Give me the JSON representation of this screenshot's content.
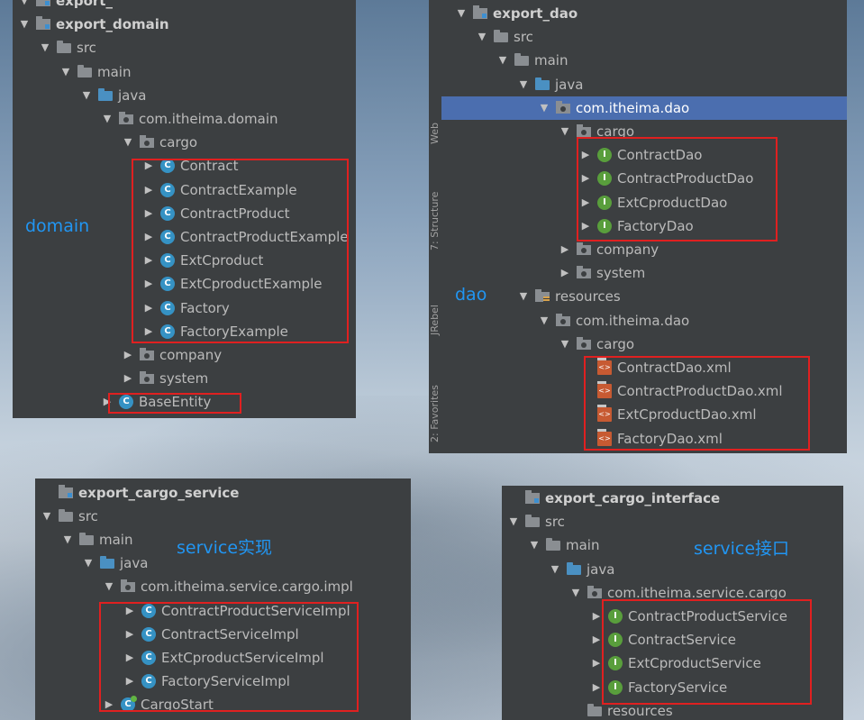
{
  "panels": {
    "domain": {
      "rows": [
        {
          "label": "export_",
          "icon": "module-icon",
          "kind": "module"
        },
        {
          "label": "export_domain",
          "icon": "module-icon",
          "kind": "module"
        },
        {
          "label": "src",
          "icon": "folder-icon",
          "kind": "folder"
        },
        {
          "label": "main",
          "icon": "folder-icon",
          "kind": "folder"
        },
        {
          "label": "java",
          "icon": "source-folder-icon",
          "kind": "source"
        },
        {
          "label": "com.itheima.domain",
          "icon": "package-icon",
          "kind": "package"
        },
        {
          "label": "cargo",
          "icon": "package-icon",
          "kind": "package"
        },
        {
          "label": "Contract",
          "icon": "class-icon",
          "kind": "class"
        },
        {
          "label": "ContractExample",
          "icon": "class-icon",
          "kind": "class"
        },
        {
          "label": "ContractProduct",
          "icon": "class-icon",
          "kind": "class"
        },
        {
          "label": "ContractProductExample",
          "icon": "class-icon",
          "kind": "class"
        },
        {
          "label": "ExtCproduct",
          "icon": "class-icon",
          "kind": "class"
        },
        {
          "label": "ExtCproductExample",
          "icon": "class-icon",
          "kind": "class"
        },
        {
          "label": "Factory",
          "icon": "class-icon",
          "kind": "class"
        },
        {
          "label": "FactoryExample",
          "icon": "class-icon",
          "kind": "class"
        },
        {
          "label": "company",
          "icon": "package-icon",
          "kind": "package"
        },
        {
          "label": "system",
          "icon": "package-icon",
          "kind": "package"
        },
        {
          "label": "BaseEntity",
          "icon": "class-icon",
          "kind": "class"
        }
      ]
    },
    "dao": {
      "rows": [
        {
          "label": "export_dao",
          "icon": "module-icon",
          "kind": "module"
        },
        {
          "label": "src",
          "icon": "folder-icon",
          "kind": "folder"
        },
        {
          "label": "main",
          "icon": "folder-icon",
          "kind": "folder"
        },
        {
          "label": "java",
          "icon": "source-folder-icon",
          "kind": "source"
        },
        {
          "label": "com.itheima.dao",
          "icon": "package-icon",
          "kind": "package",
          "selected": true
        },
        {
          "label": "cargo",
          "icon": "package-icon",
          "kind": "package"
        },
        {
          "label": "ContractDao",
          "icon": "interface-icon",
          "kind": "interface"
        },
        {
          "label": "ContractProductDao",
          "icon": "interface-icon",
          "kind": "interface"
        },
        {
          "label": "ExtCproductDao",
          "icon": "interface-icon",
          "kind": "interface"
        },
        {
          "label": "FactoryDao",
          "icon": "interface-icon",
          "kind": "interface"
        },
        {
          "label": "company",
          "icon": "package-icon",
          "kind": "package"
        },
        {
          "label": "system",
          "icon": "package-icon",
          "kind": "package"
        },
        {
          "label": "resources",
          "icon": "resources-folder-icon",
          "kind": "resources"
        },
        {
          "label": "com.itheima.dao",
          "icon": "package-icon",
          "kind": "package"
        },
        {
          "label": "cargo",
          "icon": "package-icon",
          "kind": "package"
        },
        {
          "label": "ContractDao.xml",
          "icon": "xml-file-icon",
          "kind": "xml"
        },
        {
          "label": "ContractProductDao.xml",
          "icon": "xml-file-icon",
          "kind": "xml"
        },
        {
          "label": "ExtCproductDao.xml",
          "icon": "xml-file-icon",
          "kind": "xml"
        },
        {
          "label": "FactoryDao.xml",
          "icon": "xml-file-icon",
          "kind": "xml"
        }
      ],
      "side_tabs": [
        "Web",
        "7: Structure",
        "JRebel",
        "2: Favorites"
      ]
    },
    "service": {
      "rows": [
        {
          "label": "export_cargo_service",
          "icon": "module-icon",
          "kind": "module"
        },
        {
          "label": "src",
          "icon": "folder-icon",
          "kind": "folder"
        },
        {
          "label": "main",
          "icon": "folder-icon",
          "kind": "folder"
        },
        {
          "label": "java",
          "icon": "source-folder-icon",
          "kind": "source"
        },
        {
          "label": "com.itheima.service.cargo.impl",
          "icon": "package-icon",
          "kind": "package"
        },
        {
          "label": "ContractProductServiceImpl",
          "icon": "class-icon",
          "kind": "class"
        },
        {
          "label": "ContractServiceImpl",
          "icon": "class-icon",
          "kind": "class"
        },
        {
          "label": "ExtCproductServiceImpl",
          "icon": "class-icon",
          "kind": "class"
        },
        {
          "label": "FactoryServiceImpl",
          "icon": "class-icon",
          "kind": "class"
        },
        {
          "label": "CargoStart",
          "icon": "spring-boot-class-icon",
          "kind": "start"
        }
      ]
    },
    "interface": {
      "rows": [
        {
          "label": "export_cargo_interface",
          "icon": "module-icon",
          "kind": "module"
        },
        {
          "label": "src",
          "icon": "folder-icon",
          "kind": "folder"
        },
        {
          "label": "main",
          "icon": "folder-icon",
          "kind": "folder"
        },
        {
          "label": "java",
          "icon": "source-folder-icon",
          "kind": "source"
        },
        {
          "label": "com.itheima.service.cargo",
          "icon": "package-icon",
          "kind": "package"
        },
        {
          "label": "ContractProductService",
          "icon": "interface-icon",
          "kind": "interface"
        },
        {
          "label": "ContractService",
          "icon": "interface-icon",
          "kind": "interface"
        },
        {
          "label": "ExtCproductService",
          "icon": "interface-icon",
          "kind": "interface"
        },
        {
          "label": "FactoryService",
          "icon": "interface-icon",
          "kind": "interface"
        },
        {
          "label": "resources",
          "icon": "folder-icon",
          "kind": "folder"
        }
      ]
    }
  },
  "notes": {
    "domain": "domain",
    "dao": "dao",
    "service_impl": "service实现",
    "service_interface": "service接口"
  },
  "colors": {
    "panel_bg": "#3c3f41",
    "selection": "#4b6eaf",
    "annotation_box": "#e02020",
    "annotation_text": "#2196f3"
  }
}
